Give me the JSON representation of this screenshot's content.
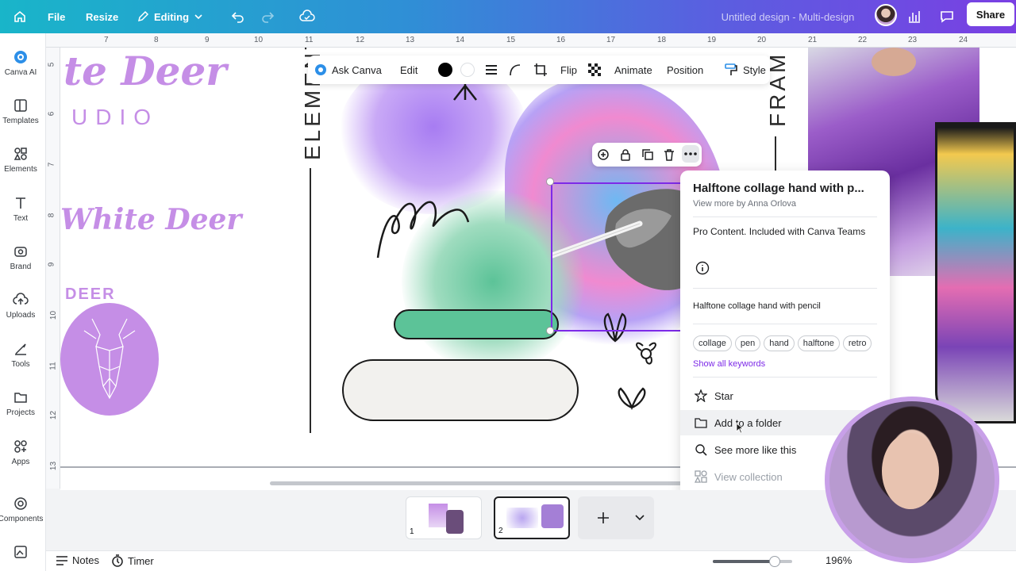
{
  "topbar": {
    "file": "File",
    "resize": "Resize",
    "editing": "Editing",
    "doc_title": "Untitled design - Multi-design",
    "share": "Share"
  },
  "sidebar": {
    "items": [
      {
        "label": "Canva AI",
        "icon": "canva-ai-icon"
      },
      {
        "label": "Templates",
        "icon": "templates-icon"
      },
      {
        "label": "Elements",
        "icon": "elements-icon"
      },
      {
        "label": "Text",
        "icon": "text-icon"
      },
      {
        "label": "Brand",
        "icon": "brand-icon"
      },
      {
        "label": "Uploads",
        "icon": "uploads-icon"
      },
      {
        "label": "Tools",
        "icon": "tools-icon"
      },
      {
        "label": "Projects",
        "icon": "projects-icon"
      },
      {
        "label": "Apps",
        "icon": "apps-icon"
      },
      {
        "label": "Components",
        "icon": "components-icon"
      }
    ]
  },
  "ruler": {
    "top": [
      "7",
      "8",
      "9",
      "10",
      "11",
      "12",
      "13",
      "14",
      "15",
      "16",
      "17",
      "18",
      "19",
      "20",
      "21",
      "22",
      "23",
      "24"
    ],
    "left": [
      "5",
      "6",
      "7",
      "8",
      "9",
      "10",
      "11",
      "12",
      "13"
    ]
  },
  "canvas": {
    "title_script": "te Deer",
    "studio": "UDIO",
    "white_deer": "White Deer",
    "deer": "DEER",
    "elements_vertical": "ELEMENTS",
    "frames_vertical": "FRAM"
  },
  "float_toolbar": {
    "ask_canva": "Ask Canva",
    "edit": "Edit",
    "flip": "Flip",
    "animate": "Animate",
    "position": "Position",
    "style": "Style",
    "fill_color": "#000000"
  },
  "panel": {
    "title": "Halftone collage hand with p...",
    "byline": "View more by Anna Orlova",
    "pro_note": "Pro Content. Included with Canva Teams",
    "description": "Halftone collage hand with pencil",
    "tags": [
      "collage",
      "pen",
      "hand",
      "halftone",
      "retro"
    ],
    "show_keywords": "Show all keywords",
    "menu": [
      {
        "label": "Star",
        "icon": "star-icon"
      },
      {
        "label": "Add to a folder",
        "icon": "folder-icon"
      },
      {
        "label": "See more like this",
        "icon": "search-icon"
      },
      {
        "label": "View collection",
        "icon": "collection-icon"
      }
    ]
  },
  "pages": {
    "page1": "1",
    "page2": "2"
  },
  "bottombar": {
    "notes": "Notes",
    "timer": "Timer",
    "zoom": "196%",
    "zoom_level": 0.78
  },
  "colors": {
    "accent_purple": "#7d2ae8",
    "script_lilac": "#c58ee6",
    "green_pill": "#5cc398"
  }
}
